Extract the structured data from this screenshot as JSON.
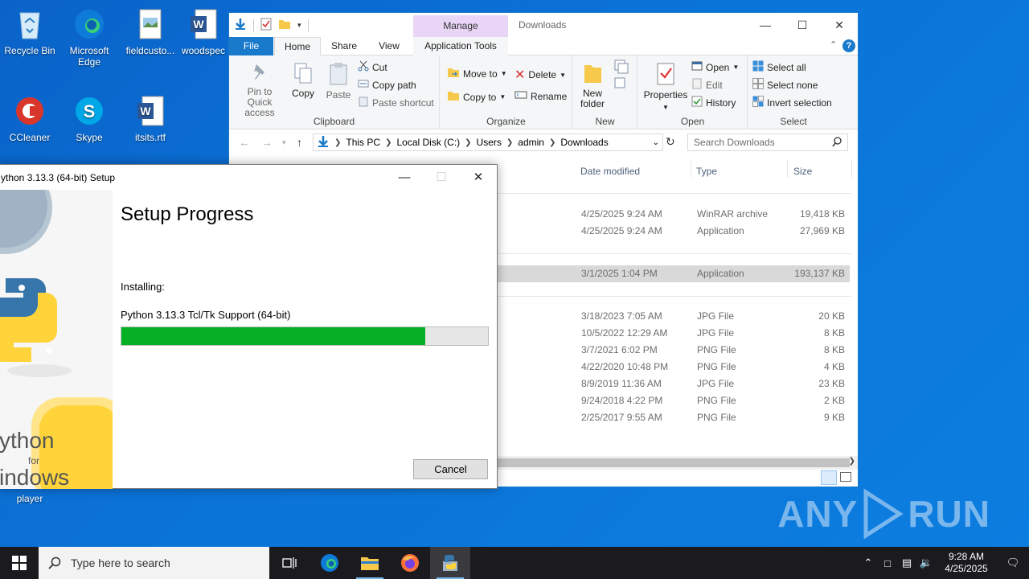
{
  "desktop": {
    "icons": [
      {
        "label": "Recycle Bin"
      },
      {
        "label": "Microsoft Edge"
      },
      {
        "label": "fieldcusto..."
      },
      {
        "label": "woodspec"
      },
      {
        "label": "CCleaner"
      },
      {
        "label": "Skype"
      },
      {
        "label": "itsits.rtf"
      },
      {
        "label": "player"
      }
    ],
    "watermark": {
      "left": "ANY",
      "right": "RUN"
    }
  },
  "explorer": {
    "title": "Downloads",
    "manage_tab": "Manage",
    "tabs": {
      "file": "File",
      "home": "Home",
      "share": "Share",
      "view": "View",
      "app_tools": "Application Tools"
    },
    "clipboard": {
      "pin": "Pin to Quick access",
      "copy": "Copy",
      "paste": "Paste",
      "cut": "Cut",
      "copy_path": "Copy path",
      "paste_shortcut": "Paste shortcut",
      "label": "Clipboard"
    },
    "organize": {
      "move_to": "Move to",
      "copy_to": "Copy to",
      "delete": "Delete",
      "rename": "Rename",
      "label": "Organize"
    },
    "new": {
      "new_folder": "New folder",
      "label": "New"
    },
    "open": {
      "properties": "Properties",
      "open": "Open",
      "edit": "Edit",
      "history": "History",
      "label": "Open"
    },
    "select": {
      "select_all": "Select all",
      "select_none": "Select none",
      "invert": "Invert selection",
      "label": "Select"
    },
    "breadcrumb": [
      "This PC",
      "Local Disk (C:)",
      "Users",
      "admin",
      "Downloads"
    ],
    "search_placeholder": "Search Downloads",
    "columns": {
      "date": "Date modified",
      "type": "Type",
      "size": "Size"
    },
    "files": [
      {
        "date": "4/25/2025 9:24 AM",
        "type": "WinRAR archive",
        "size": "19,418 KB"
      },
      {
        "date": "4/25/2025 9:24 AM",
        "type": "Application",
        "size": "27,969 KB"
      },
      {
        "date": "3/1/2025 1:04 PM",
        "type": "Application",
        "size": "193,137 KB"
      },
      {
        "date": "3/18/2023 7:05 AM",
        "type": "JPG File",
        "size": "20 KB"
      },
      {
        "date": "10/5/2022 12:29 AM",
        "type": "JPG File",
        "size": "8 KB"
      },
      {
        "date": "3/7/2021 6:02 PM",
        "type": "PNG File",
        "size": "8 KB"
      },
      {
        "date": "4/22/2020 10:48 PM",
        "type": "PNG File",
        "size": "4 KB"
      },
      {
        "date": "8/9/2019 11:36 AM",
        "type": "JPG File",
        "size": "23 KB"
      },
      {
        "date": "9/24/2018 4:22 PM",
        "type": "PNG File",
        "size": "2 KB"
      },
      {
        "date": "2/25/2017 9:55 AM",
        "type": "PNG File",
        "size": "9 KB"
      }
    ]
  },
  "setup": {
    "title": "ython 3.13.3 (64-bit) Setup",
    "heading": "Setup Progress",
    "installing_label": "Installing:",
    "component": "Python 3.13.3 Tcl/Tk Support (64-bit)",
    "progress_fraction": 0.83,
    "cancel": "Cancel",
    "side_text_1": "ython",
    "side_text_2": "for",
    "side_text_3": "indows"
  },
  "taskbar": {
    "search_placeholder": "Type here to search",
    "time": "9:28 AM",
    "date": "4/25/2025"
  },
  "colors": {
    "accent": "#1979ca",
    "progress": "#06b025",
    "manage": "#e9d6f7"
  }
}
